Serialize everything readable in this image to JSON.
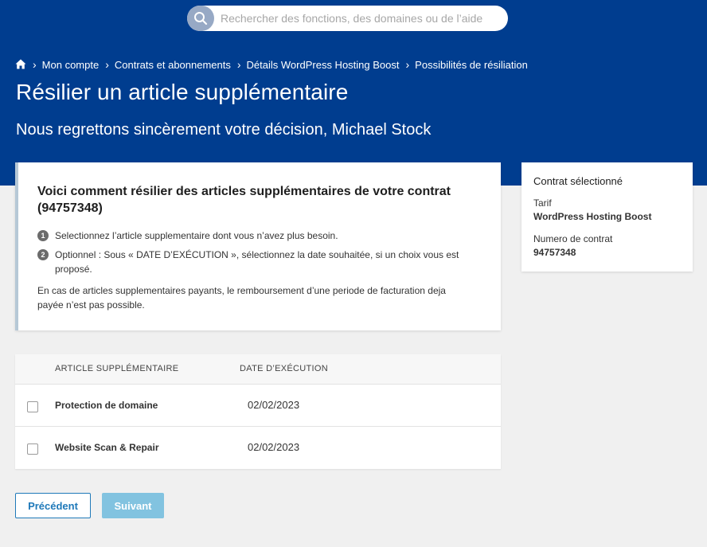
{
  "search": {
    "placeholder": "Rechercher des fonctions, des domaines ou de l’aide"
  },
  "breadcrumb": {
    "items": [
      "Mon compte",
      "Contrats et abonnements",
      "Détails WordPress Hosting Boost",
      "Possibilités de résiliation"
    ]
  },
  "header": {
    "title": "Résilier un article supplémentaire",
    "subtitle": "Nous regrettons sincèrement votre décision, Michael Stock"
  },
  "info": {
    "title": "Voici comment résilier des articles supplémentaires de votre contrat (94757348)",
    "steps": [
      {
        "num": "1",
        "text": "Selectionnez l’article supplementaire dont vous n’avez plus besoin."
      },
      {
        "num": "2",
        "text": "Optionnel : Sous « DATE D’EXÉCUTION », sélectionnez la date souhaitée, si un choix vous est proposé."
      }
    ],
    "note": "En cas de articles supplementaires payants, le remboursement d’une periode de facturation deja payée n’est pas possible."
  },
  "contract": {
    "title": "Contrat sélectionné",
    "tariff_label": "Tarif",
    "tariff_value": "WordPress Hosting Boost",
    "number_label": "Numero de contrat",
    "number_value": "94757348"
  },
  "table": {
    "headers": {
      "article": "ARTICLE SUPPLÉMENTAIRE",
      "date": "DATE D’EXÉCUTION"
    },
    "rows": [
      {
        "name": "Protection de domaine",
        "date": "02/02/2023",
        "checked": false
      },
      {
        "name": "Website Scan & Repair",
        "date": "02/02/2023",
        "checked": false
      }
    ]
  },
  "buttons": {
    "prev": "Précédent",
    "next": "Suivant"
  },
  "colors": {
    "header_bg": "#003d8f",
    "primary": "#1f79b9",
    "disabled": "#82c3e0"
  },
  "icons": {
    "search": "search-icon",
    "home": "home-icon",
    "separator": "chevron-right-icon"
  }
}
